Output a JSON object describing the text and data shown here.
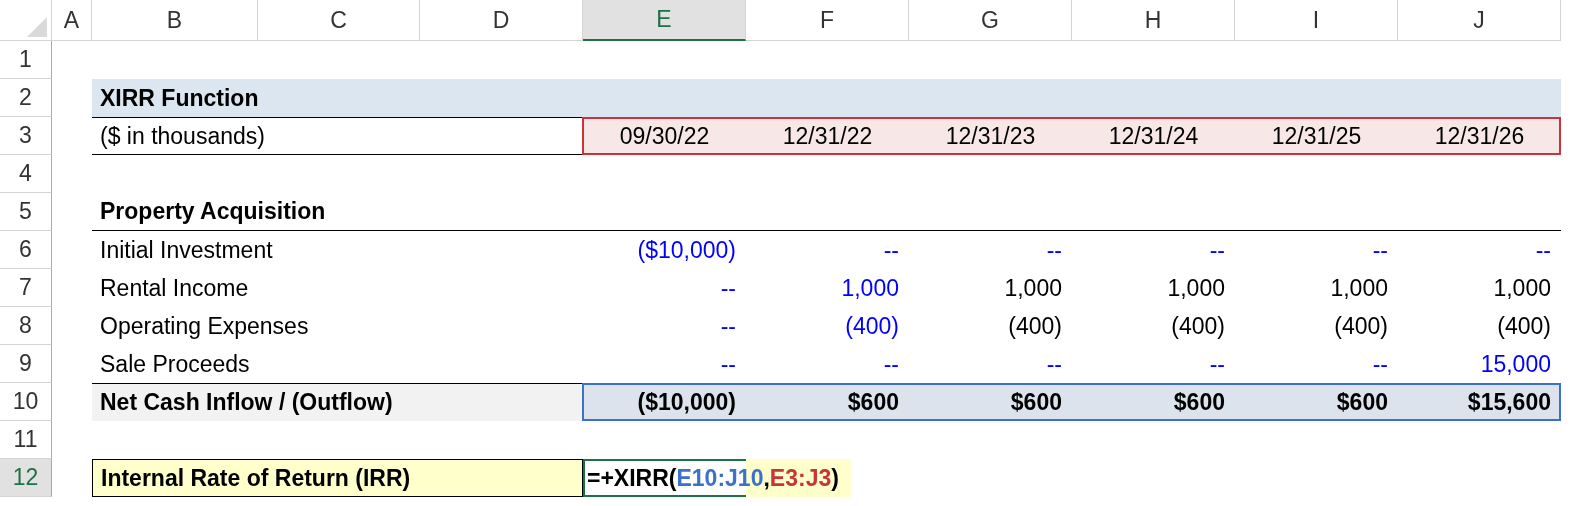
{
  "columns": [
    {
      "label": "A",
      "selected": false
    },
    {
      "label": "B",
      "selected": false
    },
    {
      "label": "C",
      "selected": false
    },
    {
      "label": "D",
      "selected": false
    },
    {
      "label": "E",
      "selected": true
    },
    {
      "label": "F",
      "selected": false
    },
    {
      "label": "G",
      "selected": false
    },
    {
      "label": "H",
      "selected": false
    },
    {
      "label": "I",
      "selected": false
    },
    {
      "label": "J",
      "selected": false
    }
  ],
  "rows": [
    {
      "label": "1",
      "selected": false
    },
    {
      "label": "2",
      "selected": false
    },
    {
      "label": "3",
      "selected": false
    },
    {
      "label": "4",
      "selected": false
    },
    {
      "label": "5",
      "selected": false
    },
    {
      "label": "6",
      "selected": false
    },
    {
      "label": "7",
      "selected": false
    },
    {
      "label": "8",
      "selected": false
    },
    {
      "label": "9",
      "selected": false
    },
    {
      "label": "10",
      "selected": false
    },
    {
      "label": "11",
      "selected": false
    },
    {
      "label": "12",
      "selected": true
    }
  ],
  "title": "XIRR Function",
  "units_label": "($ in thousands)",
  "dates": [
    "09/30/22",
    "12/31/22",
    "12/31/23",
    "12/31/24",
    "12/31/25",
    "12/31/26"
  ],
  "section_title": "Property Acquisition",
  "line_items": [
    {
      "label": "Initial Investment",
      "values": [
        {
          "text": "($10,000)",
          "input": true
        },
        {
          "text": "--",
          "input": true
        },
        {
          "text": "--",
          "input": true
        },
        {
          "text": "--",
          "input": true
        },
        {
          "text": "--",
          "input": true
        },
        {
          "text": "--",
          "input": true
        }
      ]
    },
    {
      "label": "Rental Income",
      "values": [
        {
          "text": "--",
          "input": true
        },
        {
          "text": "1,000",
          "input": true
        },
        {
          "text": "1,000",
          "input": false
        },
        {
          "text": "1,000",
          "input": false
        },
        {
          "text": "1,000",
          "input": false
        },
        {
          "text": "1,000",
          "input": false
        }
      ]
    },
    {
      "label": "Operating Expenses",
      "values": [
        {
          "text": "--",
          "input": true
        },
        {
          "text": "(400)",
          "input": true
        },
        {
          "text": "(400)",
          "input": false
        },
        {
          "text": "(400)",
          "input": false
        },
        {
          "text": "(400)",
          "input": false
        },
        {
          "text": "(400)",
          "input": false
        }
      ]
    },
    {
      "label": "Sale Proceeds",
      "values": [
        {
          "text": "--",
          "input": true
        },
        {
          "text": "--",
          "input": true
        },
        {
          "text": "--",
          "input": true
        },
        {
          "text": "--",
          "input": true
        },
        {
          "text": "--",
          "input": true
        },
        {
          "text": "15,000",
          "input": true
        }
      ]
    }
  ],
  "total": {
    "label": "Net Cash Inflow / (Outflow)",
    "values": [
      "($10,000)",
      "$600",
      "$600",
      "$600",
      "$600",
      "$15,600"
    ]
  },
  "irr": {
    "label": "Internal Rate of Return (IRR)",
    "formula": [
      {
        "text": "=+XIRR("
      },
      {
        "text": "E10:J10",
        "color": "#3a72c9"
      },
      {
        "text": ","
      },
      {
        "text": "E3:J3",
        "color": "#c8343a"
      },
      {
        "text": ")"
      }
    ]
  }
}
